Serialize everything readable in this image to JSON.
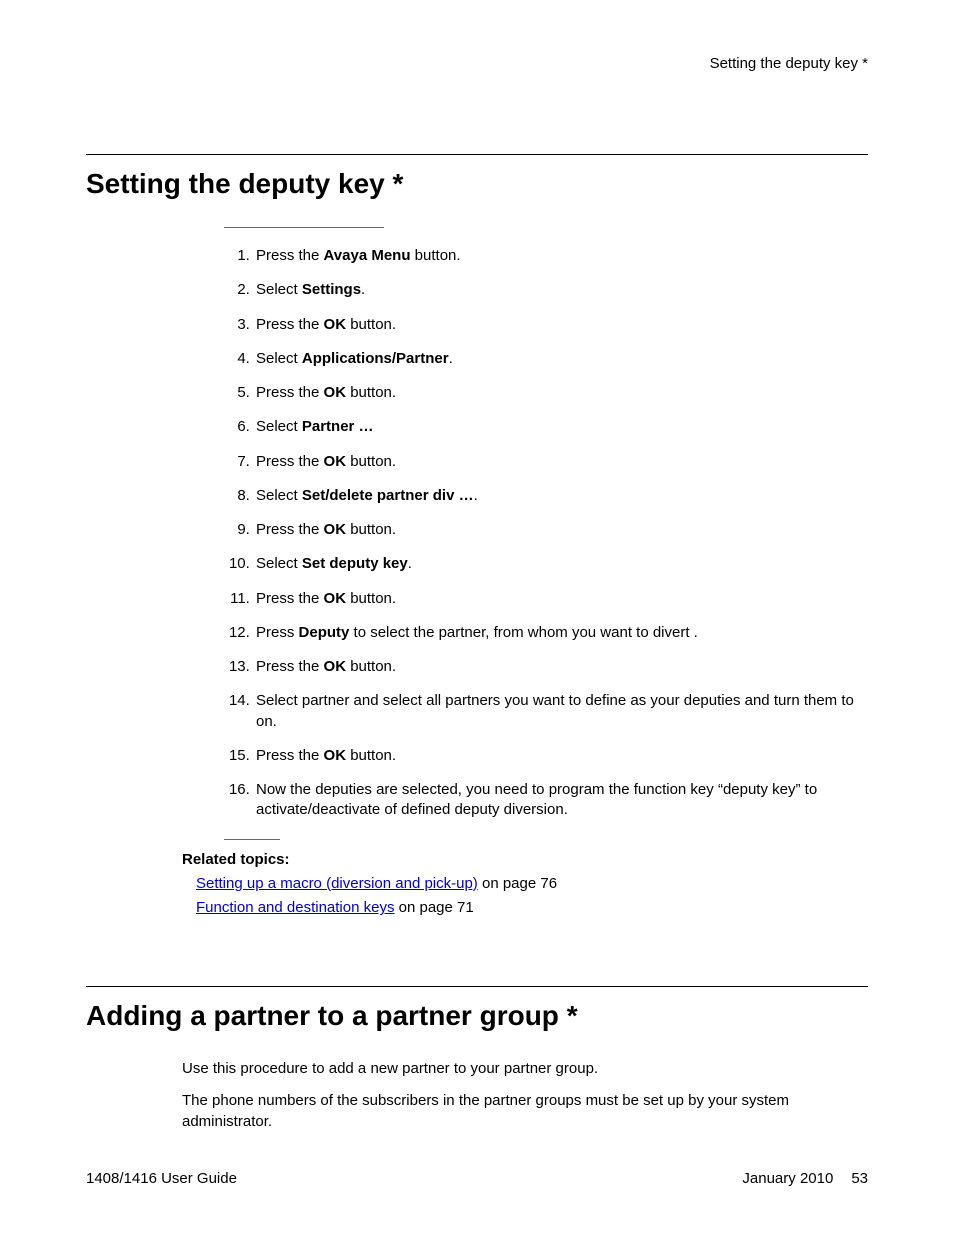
{
  "running_header": "Setting the deputy key *",
  "section1": {
    "title": "Setting the deputy key *",
    "steps": [
      {
        "pre": "Press the ",
        "bold": "Avaya Menu",
        "post": " button."
      },
      {
        "pre": "Select ",
        "bold": "Settings",
        "post": "."
      },
      {
        "pre": "Press the ",
        "bold": "OK",
        "post": " button."
      },
      {
        "pre": "Select ",
        "bold": "Applications/Partner",
        "post": "."
      },
      {
        "pre": "Press the ",
        "bold": "OK",
        "post": " button."
      },
      {
        "pre": "Select ",
        "bold": "Partner …",
        "post": ""
      },
      {
        "pre": "Press the ",
        "bold": "OK",
        "post": " button."
      },
      {
        "pre": "Select ",
        "bold": "Set/delete partner div …",
        "post": "."
      },
      {
        "pre": "Press the ",
        "bold": "OK",
        "post": " button."
      },
      {
        "pre": "Select ",
        "bold": "Set deputy key",
        "post": "."
      },
      {
        "pre": "Press the ",
        "bold": "OK",
        "post": " button."
      },
      {
        "pre": "Press ",
        "bold": "Deputy",
        "post": " to select the partner, from whom you want to divert ."
      },
      {
        "pre": "Press the ",
        "bold": "OK",
        "post": " button."
      },
      {
        "pre": "Select partner and select all partners you want to define as your deputies and turn them to on.",
        "bold": "",
        "post": ""
      },
      {
        "pre": "Press the ",
        "bold": "OK",
        "post": " button."
      },
      {
        "pre": "Now the deputies are selected, you need to program the function key “deputy key” to activate/deactivate of defined deputy diversion.",
        "bold": "",
        "post": ""
      }
    ],
    "related_title": "Related topics:",
    "related": [
      {
        "link": "Setting up a macro (diversion and pick-up)",
        "tail": " on page 76"
      },
      {
        "link": "Function and destination keys",
        "tail": " on page 71"
      }
    ]
  },
  "section2": {
    "title": "Adding a partner to a partner group *",
    "p1": "Use this procedure to add a new partner to your partner group.",
    "p2": "The phone numbers of the subscribers in the partner groups must be set up by your system administrator."
  },
  "footer": {
    "left": "1408/1416 User Guide",
    "date": "January 2010",
    "page": "53"
  }
}
